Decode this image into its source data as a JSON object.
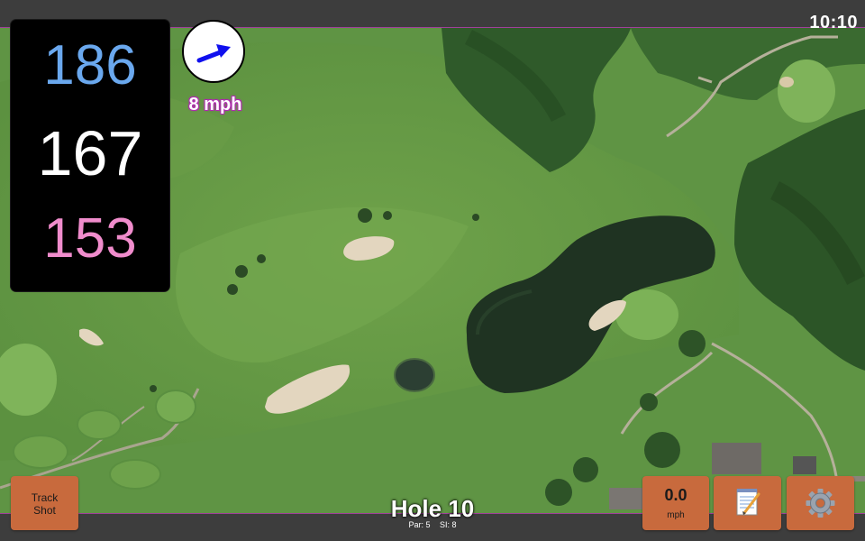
{
  "status": {
    "time": "10:10"
  },
  "distances": {
    "back": "186",
    "middle": "167",
    "front": "153"
  },
  "colors": {
    "back": "#6aa8ee",
    "middle": "#ffffff",
    "front": "#f08ccc",
    "button": "#c86a3d",
    "wind_arrow": "#1010ee",
    "accent_border": "#a0409a"
  },
  "wind": {
    "speed": "8 mph",
    "icon": "wind-direction-arrow-icon"
  },
  "buttons": {
    "track_shot": "Track\nShot",
    "speed_value": "0.0",
    "speed_unit": "mph",
    "notes_icon": "notepad-icon",
    "settings_icon": "gear-icon"
  },
  "hole": {
    "title": "Hole 10",
    "par": "Par: 5",
    "si": "SI: 8"
  }
}
